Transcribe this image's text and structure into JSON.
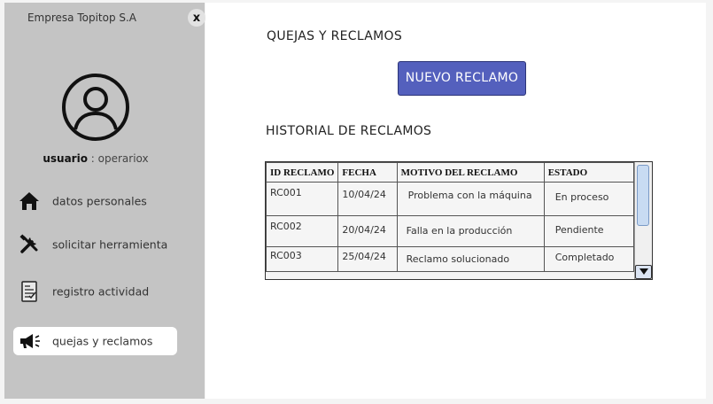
{
  "sidebar": {
    "company": "Empresa Topitop S.A",
    "close_label": "x",
    "user_label": "usuario",
    "user_sep": " : ",
    "user_name": "operariox",
    "items": [
      {
        "label": "datos personales",
        "icon": "home-icon"
      },
      {
        "label": "solicitar herramienta",
        "icon": "tools-icon"
      },
      {
        "label": "registro actividad",
        "icon": "document-icon"
      },
      {
        "label": "quejas y reclamos",
        "icon": "megaphone-icon",
        "active": true
      }
    ]
  },
  "main": {
    "title": "QUEJAS Y RECLAMOS",
    "new_button": "NUEVO RECLAMO",
    "history_title": "HISTORIAL DE RECLAMOS",
    "table": {
      "headers": [
        "ID RECLAMO",
        "FECHA",
        "MOTIVO DEL RECLAMO",
        "ESTADO"
      ],
      "rows": [
        [
          "RC001",
          "10/04/24",
          "Problema con la máquina",
          "En proceso"
        ],
        [
          "RC002",
          "20/04/24",
          "Falla en la producción",
          "Pendiente"
        ],
        [
          "RC003",
          "25/04/24",
          "Reclamo solucionado",
          "Completado"
        ]
      ]
    }
  },
  "colors": {
    "sidebar_bg": "#c4c4c4",
    "accent_button": "#5460bd",
    "active_item_bg": "#ffffff"
  }
}
